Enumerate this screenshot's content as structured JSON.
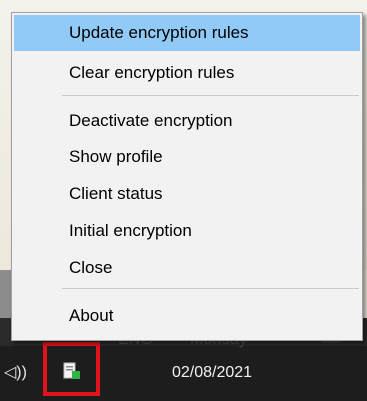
{
  "context_menu": {
    "items": [
      {
        "label": "Update encryption rules",
        "highlighted": true
      },
      {
        "label": "Clear encryption rules"
      },
      {
        "label": "Deactivate encryption"
      },
      {
        "label": "Show profile"
      },
      {
        "label": "Client status"
      },
      {
        "label": "Initial encryption"
      },
      {
        "label": "Close"
      },
      {
        "label": "About"
      }
    ],
    "highlight_color": "#91c9f7"
  },
  "taskbar": {
    "date": "02/08/2021",
    "volume_icon": "speaker-volume-icon",
    "tray_app_icon": "encryption-client-tray-icon",
    "highlight_color": "#e0131b"
  }
}
